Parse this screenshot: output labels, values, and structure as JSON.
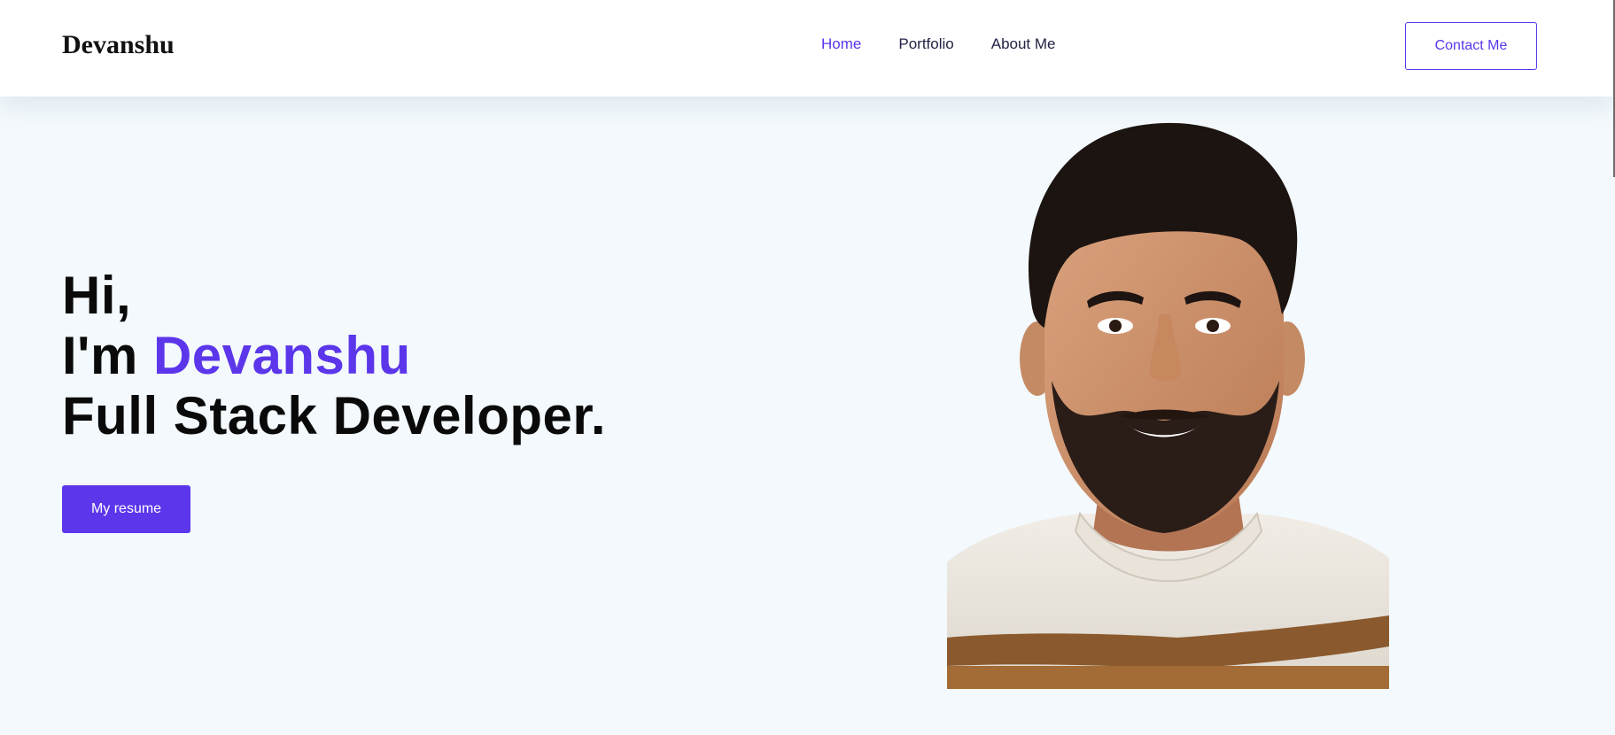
{
  "navbar": {
    "brand": "Devanshu",
    "links": [
      {
        "label": "Home",
        "active": true
      },
      {
        "label": "Portfolio",
        "active": false
      },
      {
        "label": "About Me",
        "active": false
      }
    ],
    "contact_label": "Contact Me"
  },
  "hero": {
    "greeting": "Hi,",
    "intro_prefix": "I'm ",
    "name": "Devanshu",
    "role": "Full Stack Developer.",
    "resume_label": "My resume"
  },
  "colors": {
    "accent": "#5b36ea",
    "background": "#f3f9fc",
    "navbar_bg": "#ffffff",
    "text": "#0a0a0a"
  },
  "portrait": {
    "subject": "smiling bearded man in white knit sweater with brown stripes"
  }
}
